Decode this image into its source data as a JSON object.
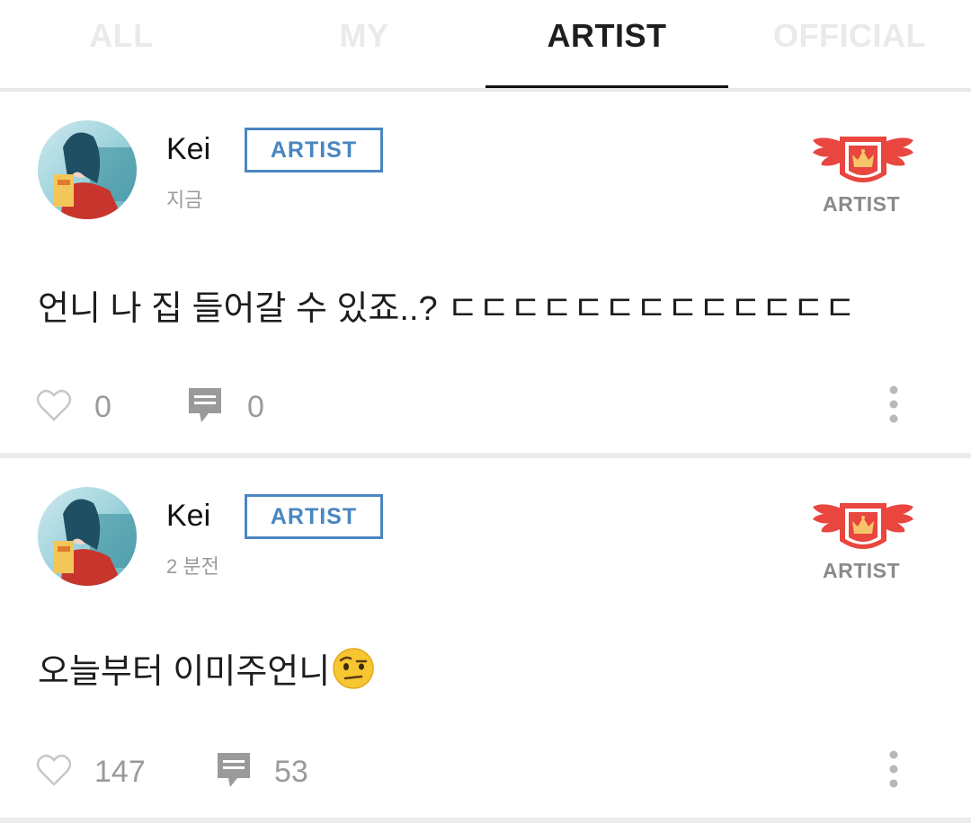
{
  "tabs": [
    {
      "label": "ALL",
      "active": false
    },
    {
      "label": "MY",
      "active": false
    },
    {
      "label": "ARTIST",
      "active": true
    },
    {
      "label": "OFFICIAL",
      "active": false
    }
  ],
  "colors": {
    "artist_tag": "#4a86c1",
    "badge_red": "#e8463f",
    "muted_text": "#9a9a9a",
    "active_tab": "#1e1e1e",
    "inactive_tab": "#eaeaea"
  },
  "posts": [
    {
      "username": "Kei",
      "tag": "ARTIST",
      "timestamp": "지금",
      "badge_label": "ARTIST",
      "content": "언니 나 집 들어갈 수 있죠..? ㄷㄷㄷㄷㄷㄷㄷㄷㄷㄷㄷㄷㄷ",
      "emoji": "",
      "likes": "0",
      "comments": "0"
    },
    {
      "username": "Kei",
      "tag": "ARTIST",
      "timestamp": "2 분전",
      "badge_label": "ARTIST",
      "content": "오늘부터 이미주언니",
      "emoji": "face-with-raised-eyebrow",
      "likes": "147",
      "comments": "53"
    }
  ]
}
